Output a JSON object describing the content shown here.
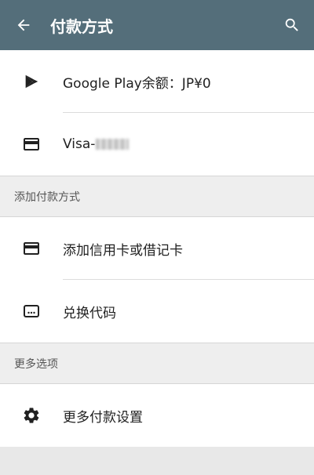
{
  "appbar": {
    "title": "付款方式",
    "back_icon": "arrow-back-icon",
    "search_icon": "search-icon",
    "color": "#546e7a"
  },
  "methods": [
    {
      "icon": "google-play-icon",
      "label": "Google Play余额：JP¥0"
    },
    {
      "icon": "credit-card-icon",
      "label": "Visa-"
    }
  ],
  "add_section": {
    "header": "添加付款方式",
    "items": [
      {
        "icon": "credit-card-icon",
        "label": "添加信用卡或借记卡"
      },
      {
        "icon": "redeem-code-icon",
        "label": "兑换代码"
      }
    ]
  },
  "more_section": {
    "header": "更多选项",
    "items": [
      {
        "icon": "gear-icon",
        "label": "更多付款设置"
      }
    ]
  }
}
